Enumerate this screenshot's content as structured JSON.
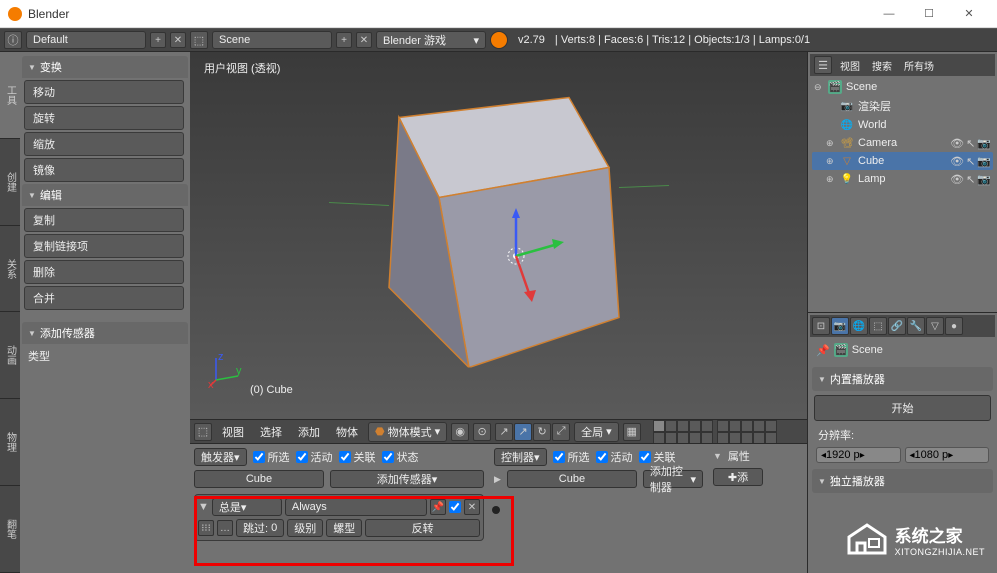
{
  "title": "Blender",
  "topbar": {
    "layout": "Default",
    "scene": "Scene",
    "engine": "Blender 游戏",
    "version": "v2.79",
    "stats": "Verts:8 | Faces:6 | Tris:12 | Objects:1/3 | Lamps:0/1"
  },
  "left_tabs": [
    "工具",
    "创建",
    "关系",
    "动画",
    "物理",
    "翻笔"
  ],
  "tool_panels": {
    "transform": {
      "header": "变换",
      "items": [
        "移动",
        "旋转",
        "缩放",
        "镜像"
      ]
    },
    "edit": {
      "header": "编辑",
      "items": [
        "复制",
        "复制链接项",
        "删除",
        "合并"
      ]
    },
    "add_sensor": {
      "header": "添加传感器",
      "type_label": "类型"
    }
  },
  "viewport": {
    "label": "用户视图  (透视)",
    "object_label": "(0) Cube",
    "menus": [
      "视图",
      "选择",
      "添加",
      "物体"
    ],
    "mode": "物体模式",
    "shading_label": "全局"
  },
  "logic": {
    "sensors_label": "触发器",
    "controllers_label": "控制器",
    "cb_sel": "所选",
    "cb_act": "活动",
    "cb_link": "关联",
    "cb_state": "状态",
    "cube_label": "Cube",
    "add_sensor": "添加传感器",
    "add_controller": "添加控制器",
    "sensor": {
      "type": "总是",
      "name": "Always",
      "skip_label": "跳过:",
      "skip_val": "0",
      "level": "级别",
      "tap": "螺型",
      "invert": "反转",
      "pulse": "…"
    },
    "props_label": "属性",
    "add_btn": "添"
  },
  "outliner": {
    "menus": [
      "视图",
      "搜索",
      "所有场"
    ],
    "scene": "Scene",
    "items": [
      {
        "name": "渲染层",
        "icon": "📷",
        "expandable": false
      },
      {
        "name": "World",
        "icon": "🌐",
        "expandable": false
      },
      {
        "name": "Camera",
        "icon": "📽",
        "expandable": true
      },
      {
        "name": "Cube",
        "icon": "▽",
        "active": true,
        "expandable": true
      },
      {
        "name": "Lamp",
        "icon": "💡",
        "expandable": true
      }
    ]
  },
  "properties": {
    "scene_crumb": "Scene",
    "player_section": "内置播放器",
    "start_btn": "开始",
    "res_label": "分辨率:",
    "res_w": "1920 p",
    "res_h": "1080 p",
    "standalone_section": "独立播放器"
  },
  "watermark": "系统之家",
  "watermark_url": "XITONGZHIJIA.NET"
}
